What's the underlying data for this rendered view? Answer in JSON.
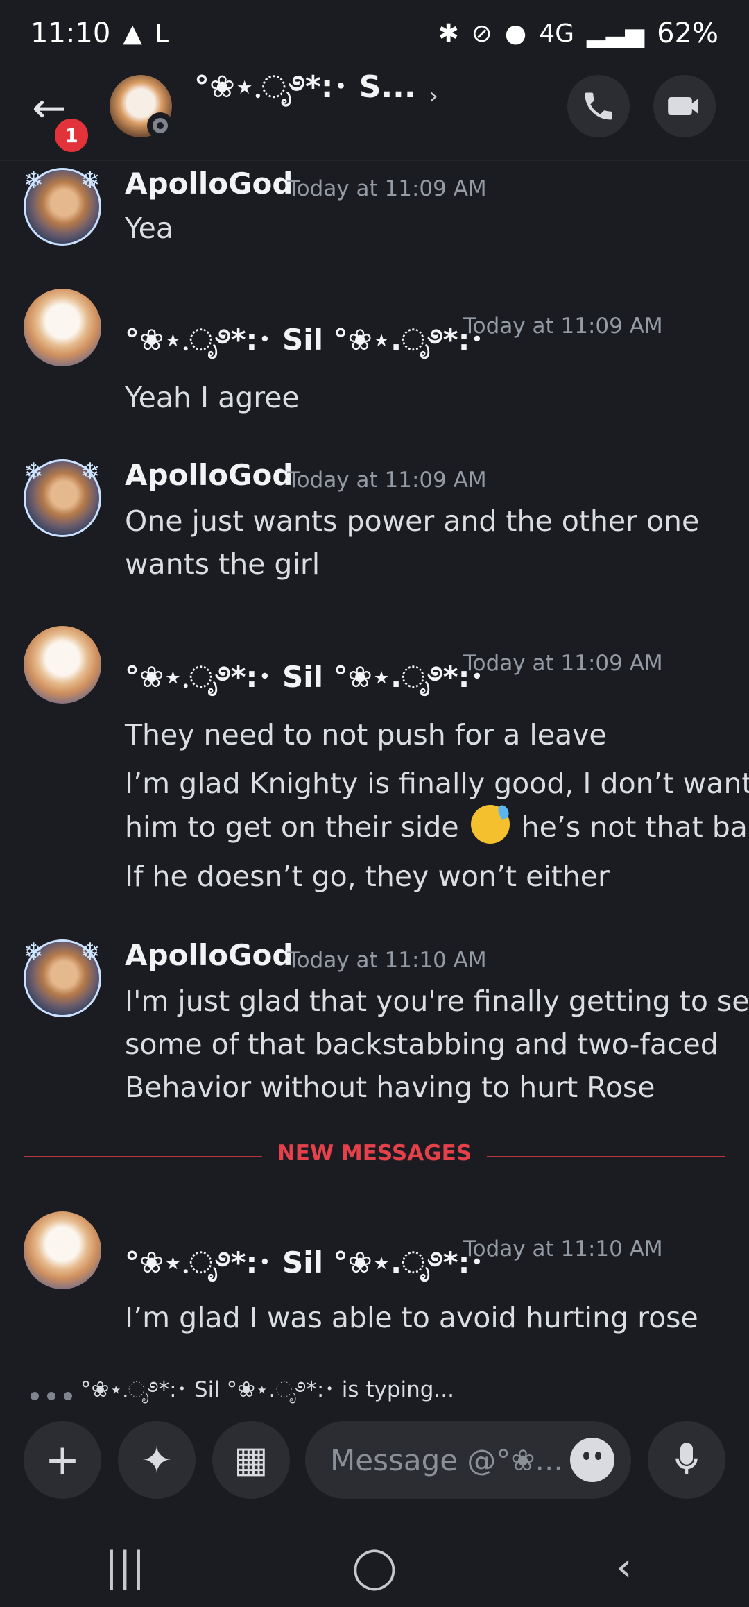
{
  "status_bar": {
    "time": "11:10",
    "left_icons": [
      "navigation-arrow-icon",
      "l-app-icon"
    ],
    "right_icons": [
      "bluetooth-icon",
      "muted-vibrate-icon",
      "location-icon",
      "4g-lte-icon",
      "signal-icon"
    ],
    "network": "4G",
    "battery": "62%"
  },
  "header": {
    "back_badge": "1",
    "title": "°❀⋆.ೃ࿔*:･ S...",
    "chevron": "›",
    "call_icon": "phone-icon",
    "video_icon": "video-camera-icon"
  },
  "messages": [
    {
      "author": "ApolloGod",
      "time": "Today at 11:09 AM",
      "lines": [
        "Yea"
      ]
    },
    {
      "author": "°❀⋆.ೃ࿔*:･ Sil °❀⋆.ೃ࿔*:･",
      "time": "Today at 11:09 AM",
      "lines": [
        "Yeah I agree"
      ]
    },
    {
      "author": "ApolloGod",
      "time": "Today at 11:09 AM",
      "lines": [
        "One just wants power and the other one",
        "wants the girl"
      ]
    },
    {
      "author": "°❀⋆.ೃ࿔*:･ Sil °❀⋆.ೃ࿔*:･",
      "time": "Today at 11:09 AM",
      "lines": [
        "They need to not push for a leave",
        "I’m glad Knighty is finally good, I don’t want",
        "him to get on their side",
        "he’s not that bad",
        "If he doesn’t go, they won’t either"
      ]
    },
    {
      "author": "ApolloGod",
      "time": "Today at 11:10 AM",
      "lines": [
        "I'm just glad that you're finally getting to see",
        "some of that backstabbing and two-faced",
        "Behavior without having to hurt Rose"
      ]
    },
    {
      "author": "°❀⋆.ೃ࿔*:･ Sil °❀⋆.ೃ࿔*:･",
      "time": "Today at 11:10 AM",
      "lines": [
        "I’m glad I was able to avoid hurting rose"
      ]
    }
  ],
  "divider_label": "NEW MESSAGES",
  "typing_text": "°❀⋆.ೃ࿔*:･ Sil °❀⋆.ೃ࿔*:･ is typing...",
  "composer": {
    "placeholder": "Message @°❀...",
    "buttons": [
      "plus-icon",
      "apps-icon",
      "gift-icon",
      "emoji-icon",
      "microphone-icon"
    ]
  },
  "nav": {
    "recent": "|||",
    "home": "◯",
    "back": "‹"
  }
}
